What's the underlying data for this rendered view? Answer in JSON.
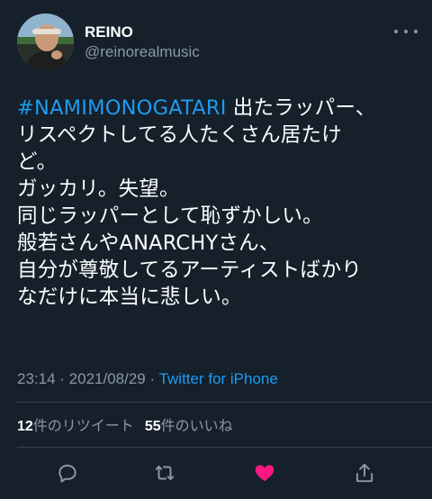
{
  "user": {
    "display_name": "REINO",
    "handle": "@reinorealmusic"
  },
  "tweet": {
    "hashtag": "#NAMIMONOGATARI",
    "text": " 出たラッパー、\nリスペクトしてる人たくさん居たけ\nど。\nガッカリ。失望。\n同じラッパーとして恥ずかしい。\n般若さんやANARCHYさん、\n自分が尊敬してるアーティストばかり\nなだけに本当に悲しい。"
  },
  "meta": {
    "time": "23:14",
    "separator": " · ",
    "date": "2021/08/29",
    "source": "Twitter for iPhone"
  },
  "stats": {
    "retweets_count": "12",
    "retweets_label": "件のリツイート",
    "likes_count": "55",
    "likes_label": "件のいいね"
  },
  "actions": {
    "reply_icon": "reply-icon",
    "retweet_icon": "retweet-icon",
    "like_icon": "heart-icon",
    "share_icon": "share-icon",
    "like_color": "#f91880",
    "icon_color": "#8b98a5"
  },
  "colors": {
    "background": "#15202b",
    "link": "#1d9bf0",
    "secondary_text": "#8b98a5",
    "divider": "#38444d"
  }
}
